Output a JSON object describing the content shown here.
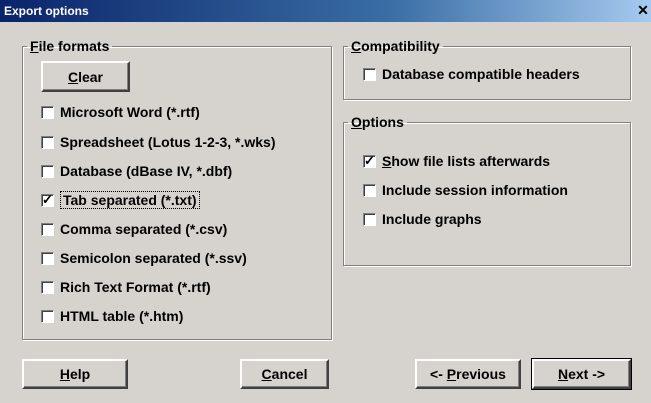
{
  "window": {
    "title": "Export options",
    "close_glyph": "✕",
    "close_icon": "close-icon"
  },
  "file_formats": {
    "legend_prefix": "F",
    "legend_rest": "ile formats",
    "clear_prefix": "C",
    "clear_rest": "lear",
    "items": [
      {
        "label": "Microsoft Word (*.rtf)",
        "checked": false
      },
      {
        "label": "Spreadsheet (Lotus 1-2-3, *.wks)",
        "checked": false
      },
      {
        "label": "Database (dBase IV, *.dbf)",
        "checked": false
      },
      {
        "label": "Tab separated (*.txt)",
        "checked": true
      },
      {
        "label": "Comma separated (*.csv)",
        "checked": false
      },
      {
        "label": "Semicolon separated (*.ssv)",
        "checked": false
      },
      {
        "label": "Rich Text Format (*.rtf)",
        "checked": false
      },
      {
        "label": "HTML table (*.htm)",
        "checked": false
      }
    ]
  },
  "compatibility": {
    "legend_prefix": "C",
    "legend_rest": "ompatibility",
    "items": [
      {
        "label": "Database compatible headers",
        "checked": false
      }
    ]
  },
  "options": {
    "legend_prefix": "O",
    "legend_rest": "ptions",
    "items": [
      {
        "prefix": "S",
        "rest": "how file lists afterwards",
        "checked": true
      },
      {
        "prefix": "",
        "rest": "Include session information",
        "checked": false
      },
      {
        "prefix": "",
        "rest": "Include graphs",
        "checked": false
      }
    ]
  },
  "buttons": {
    "help_prefix": "H",
    "help_rest": "elp",
    "cancel_prefix": "C",
    "cancel_rest": "ancel",
    "previous_before": "<- ",
    "previous_prefix": "P",
    "previous_rest": "revious",
    "next_prefix": "N",
    "next_rest": "ext ->"
  },
  "check_glyph": "✓"
}
